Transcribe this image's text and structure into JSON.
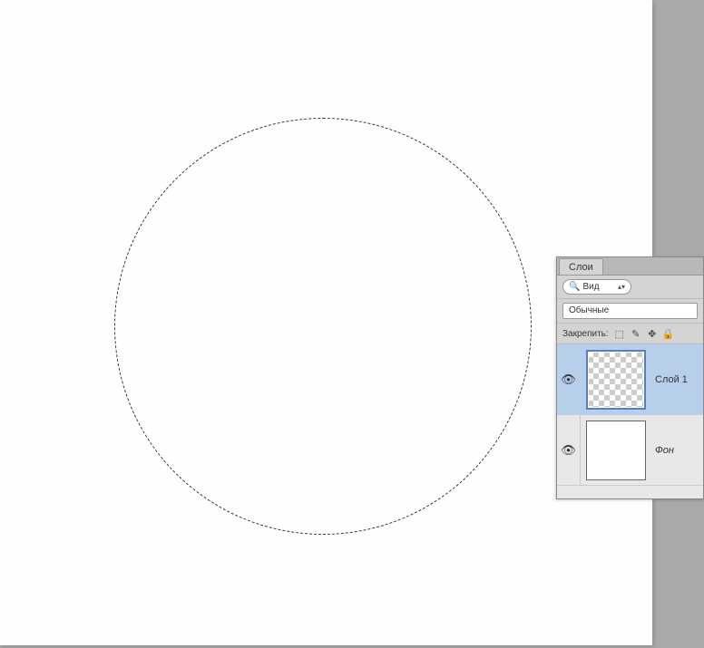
{
  "panel": {
    "tabs": {
      "layers": "Слои"
    },
    "filter": {
      "label": "Вид"
    },
    "blend_mode": "Обычные",
    "lock": {
      "label": "Закрепить:",
      "icons": {
        "transparency": "⬚",
        "pixels": "✎",
        "position": "✥",
        "all": "🔒"
      }
    }
  },
  "layers": [
    {
      "name": "Слой 1",
      "selected": true,
      "visible": true,
      "thumb": "checker",
      "name_style": "normal"
    },
    {
      "name": "Фон",
      "selected": false,
      "visible": true,
      "thumb": "white",
      "name_style": "italic"
    }
  ],
  "icons": {
    "eye": "👁",
    "search": "🔍",
    "updown": "▴▾"
  }
}
